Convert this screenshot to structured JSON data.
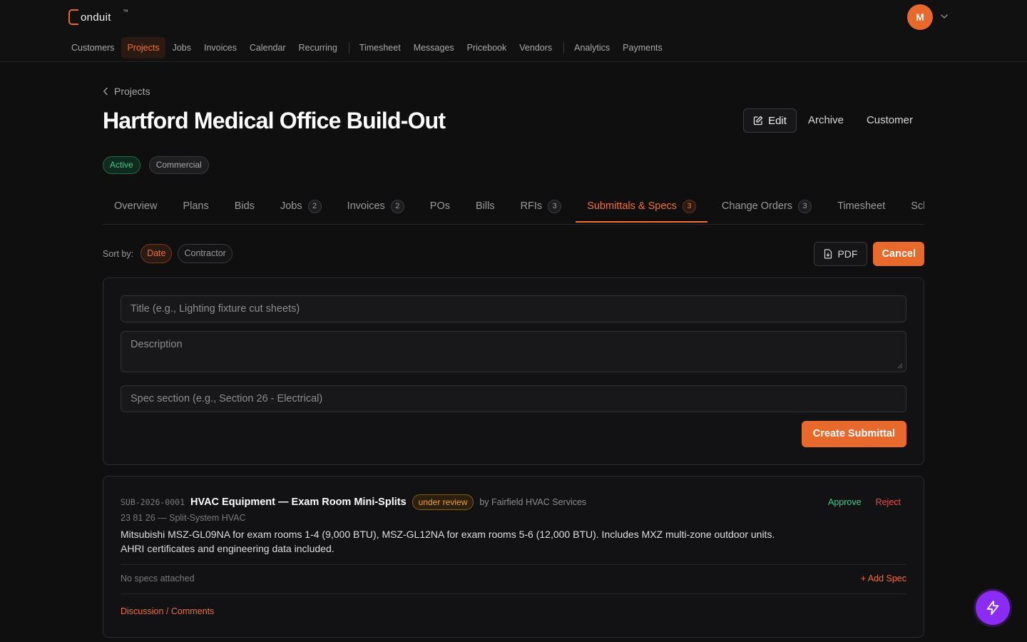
{
  "app": {
    "logo_text": "onduit",
    "logo_tm": "™"
  },
  "nav": {
    "items": [
      {
        "label": "Customers"
      },
      {
        "label": "Projects"
      },
      {
        "label": "Jobs"
      },
      {
        "label": "Invoices"
      },
      {
        "label": "Calendar"
      },
      {
        "label": "Recurring"
      },
      {
        "label": "Timesheet"
      },
      {
        "label": "Messages"
      },
      {
        "label": "Pricebook"
      },
      {
        "label": "Vendors"
      },
      {
        "label": "Analytics"
      },
      {
        "label": "Payments"
      }
    ],
    "active": "Projects"
  },
  "user": {
    "initial": "M"
  },
  "header": {
    "breadcrumb": "Projects",
    "title": "Hartford Medical Office Build-Out",
    "edit_label": "Edit",
    "archive_label": "Archive",
    "customer_label": "Customer"
  },
  "tags": {
    "status": "Active",
    "type": "Commercial"
  },
  "tabs": [
    {
      "label": "Overview",
      "count": ""
    },
    {
      "label": "Plans",
      "count": ""
    },
    {
      "label": "Bids",
      "count": ""
    },
    {
      "label": "Jobs",
      "count": "2"
    },
    {
      "label": "Invoices",
      "count": "2"
    },
    {
      "label": "POs",
      "count": ""
    },
    {
      "label": "Bills",
      "count": ""
    },
    {
      "label": "RFIs",
      "count": "3"
    },
    {
      "label": "Submittals & Specs",
      "count": "3"
    },
    {
      "label": "Change Orders",
      "count": "3"
    },
    {
      "label": "Timesheet",
      "count": ""
    },
    {
      "label": "Sche",
      "count": ""
    }
  ],
  "sort": {
    "label": "Sort by:",
    "options": [
      "Date",
      "Contractor"
    ],
    "selected": "Date"
  },
  "toolbar": {
    "pdf_label": "PDF",
    "cancel_label": "Cancel"
  },
  "form": {
    "title_placeholder": "Title (e.g., Lighting fixture cut sheets)",
    "description_placeholder": "Description",
    "spec_placeholder": "Spec section (e.g., Section 26 - Electrical)",
    "submit_label": "Create Submittal"
  },
  "submittal": {
    "id": "SUB-2026-0001",
    "title": "HVAC Equipment — Exam Room Mini-Splits",
    "status": "under review",
    "by": "by Fairfield HVAC Services",
    "spec_section": "23 81 26 — Split-System HVAC",
    "description_line1": "Mitsubishi MSZ-GL09NA for exam rooms 1-4 (9,000 BTU), MSZ-GL12NA for exam rooms 5-6 (12,000 BTU). Includes MXZ multi-zone outdoor units.",
    "description_line2": "AHRI certificates and engineering data included.",
    "approve_label": "Approve",
    "reject_label": "Reject",
    "no_specs": "No specs attached",
    "add_spec": "+ Add Spec",
    "discussion": "Discussion / Comments"
  },
  "colors": {
    "accent": "#e8692c",
    "success": "#3ec98a",
    "danger": "#ef4b4b",
    "warning": "#f0a030",
    "fab": "#8b2cf5"
  },
  "icons": {
    "back": "chevron-left-icon",
    "edit": "edit-icon",
    "pdf": "file-pdf-icon",
    "fab": "bolt-icon",
    "user_menu": "chevron-down-icon"
  }
}
